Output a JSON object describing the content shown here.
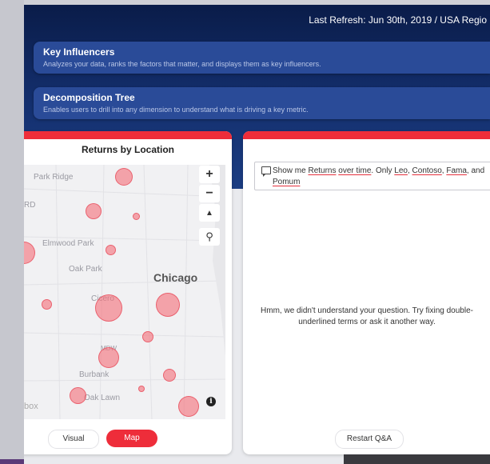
{
  "header": {
    "refresh_text": "Last Refresh: Jun 30th, 2019 / USA Regio"
  },
  "banners": [
    {
      "title": "Key Influencers",
      "subtitle": "Analyzes your data, ranks the factors that matter, and displays them as key influencers."
    },
    {
      "title": "Decomposition Tree",
      "subtitle": "Enables users to drill into any dimension to understand what is driving a key metric."
    }
  ],
  "map_card": {
    "title": "Returns by Location",
    "place_labels": [
      "Park Ridge",
      "Elmwood Park",
      "Oak Park",
      "Cicero",
      "Burbank",
      "Oak Lawn",
      "MDW",
      "RD"
    ],
    "city_label": "Chicago",
    "attribution": "box",
    "controls": {
      "zoom_in": "+",
      "zoom_out": "−",
      "compass": "▲",
      "search": "⚲"
    },
    "info_glyph": "i",
    "footer": {
      "visual_label": "Visual",
      "map_label": "Map"
    }
  },
  "qa_card": {
    "query_parts": [
      {
        "text": "Show me ",
        "underline": false
      },
      {
        "text": "Returns",
        "underline": true
      },
      {
        "text": " ",
        "underline": false
      },
      {
        "text": "over time",
        "underline": true
      },
      {
        "text": ". Only ",
        "underline": false
      },
      {
        "text": "Leo",
        "underline": true
      },
      {
        "text": ", ",
        "underline": false
      },
      {
        "text": "Contoso",
        "underline": true
      },
      {
        "text": ", ",
        "underline": false
      },
      {
        "text": "Fama",
        "underline": true
      },
      {
        "text": ", and ",
        "underline": false
      },
      {
        "text": "Pomum",
        "underline": true
      }
    ],
    "message": "Hmm, we didn't understand your question. Try fixing double-underlined terms or ask it another way.",
    "restart_label": "Restart Q&A"
  },
  "colors": {
    "accent_red": "#ee2d3a",
    "navy": "#0a1c49",
    "banner_blue": "#2a4b98",
    "bubble_fill": "#f56e78"
  }
}
